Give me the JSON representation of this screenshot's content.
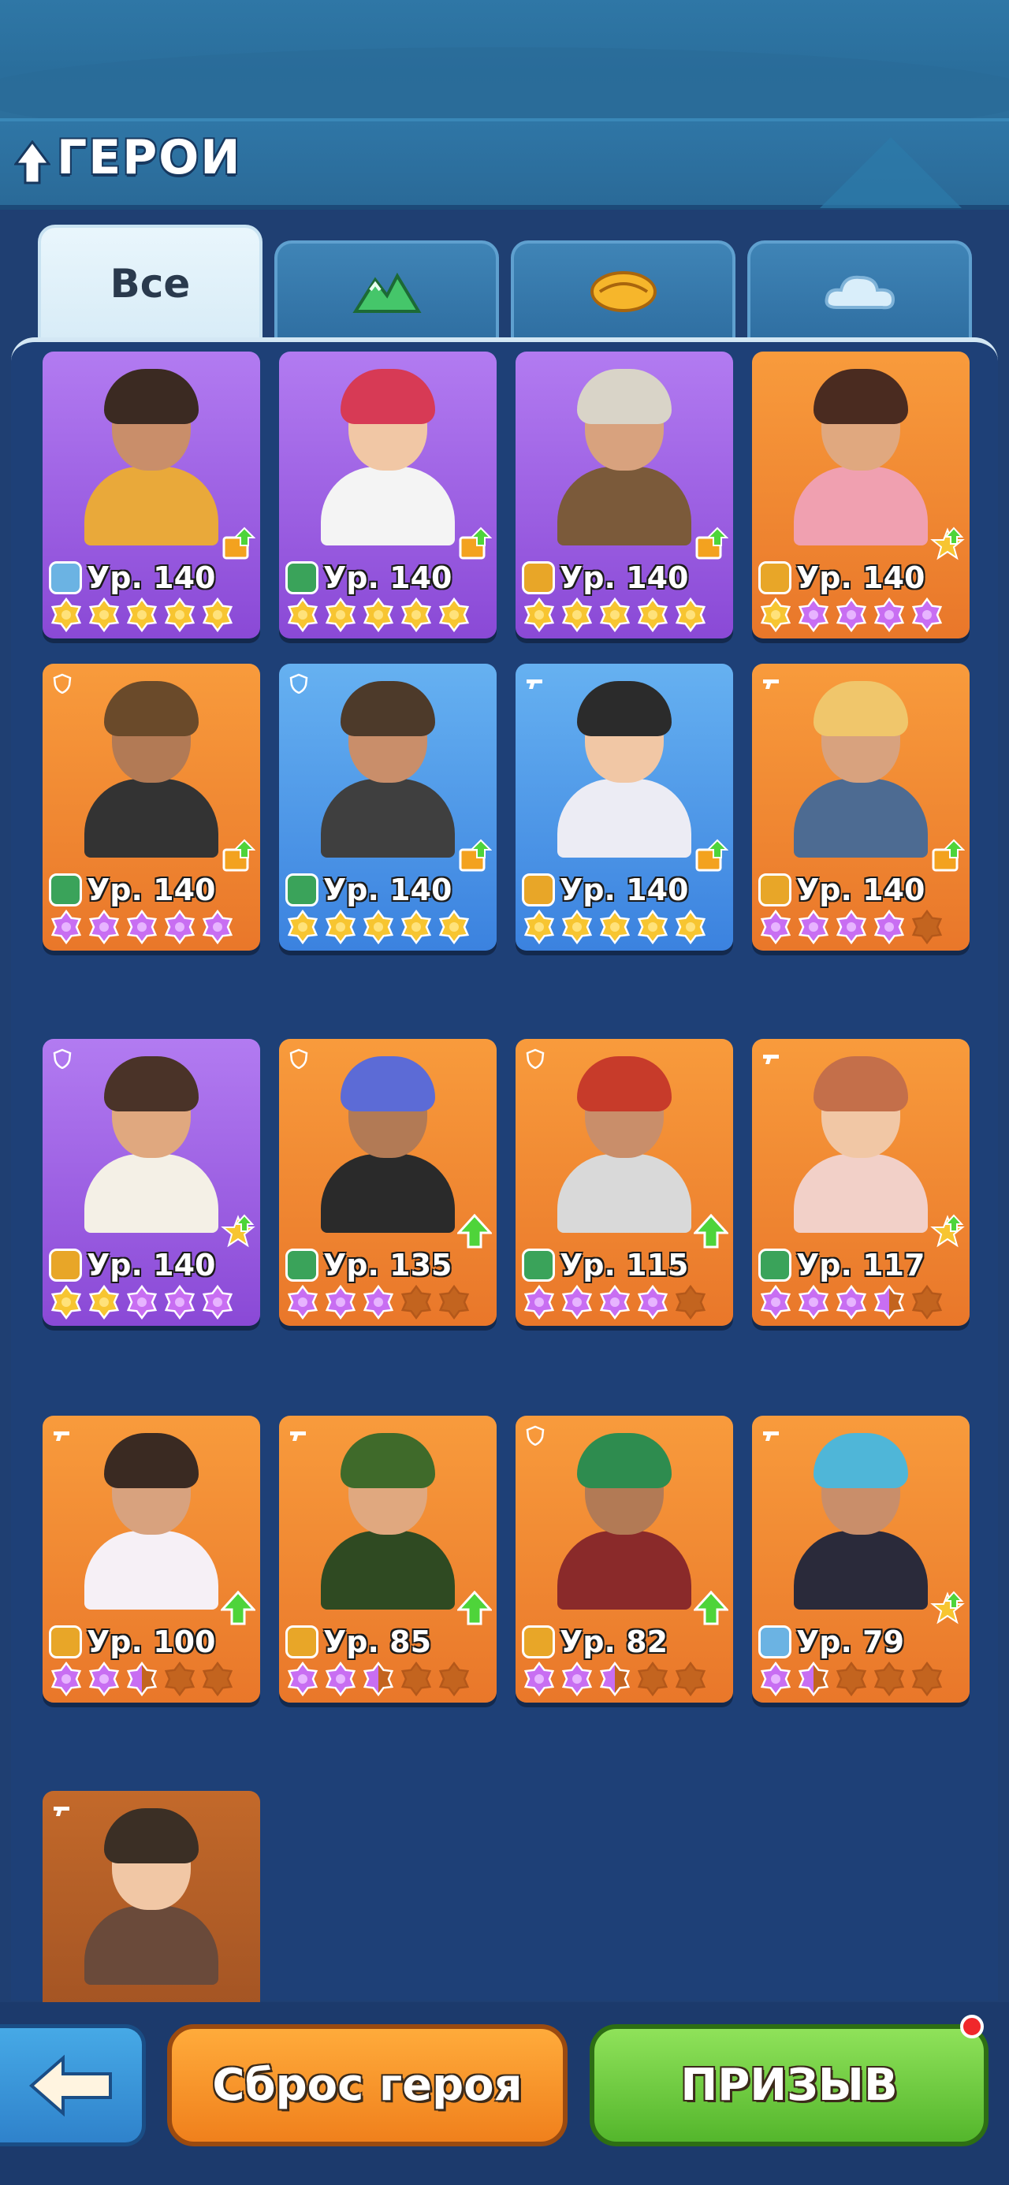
{
  "header": {
    "title": "ГЕРОИ"
  },
  "tabs": [
    {
      "label": "Все",
      "icon": "all",
      "active": true
    },
    {
      "label": "",
      "icon": "mountain-faction-icon",
      "active": false
    },
    {
      "label": "",
      "icon": "desert-faction-icon",
      "active": false
    },
    {
      "label": "",
      "icon": "cloud-faction-icon",
      "active": false
    }
  ],
  "colors": {
    "orange_card": "#f0872f",
    "purple_card": "#9a5ce3",
    "blue_card": "#4f98e8",
    "gold_star": "#f7c531",
    "purple_star": "#c86ef2",
    "empty_star": "#c3641f"
  },
  "heroes": [
    {
      "level": "Ур. 140",
      "card": "purple",
      "faction": "sky",
      "upgrade": "book",
      "stars": [
        "gold",
        "gold",
        "gold",
        "gold",
        "gold"
      ]
    },
    {
      "level": "Ур. 140",
      "card": "purple",
      "faction": "mountain",
      "upgrade": "book",
      "stars": [
        "gold",
        "gold",
        "gold",
        "gold",
        "gold"
      ]
    },
    {
      "level": "Ур. 140",
      "card": "purple",
      "faction": "desert",
      "upgrade": "book",
      "stars": [
        "gold",
        "gold",
        "gold",
        "gold",
        "gold"
      ]
    },
    {
      "level": "Ур. 140",
      "card": "orange",
      "faction": "desert",
      "upgrade": "star",
      "stars": [
        "gold",
        "purple",
        "purple",
        "purple",
        "purple"
      ]
    },
    {
      "level": "Ур. 140",
      "card": "orange",
      "faction": "mountain",
      "upgrade": "book",
      "role": "shield",
      "stars": [
        "purple",
        "purple",
        "purple",
        "purple",
        "purple"
      ]
    },
    {
      "level": "Ур. 140",
      "card": "blue",
      "faction": "mountain",
      "upgrade": "book",
      "role": "shield",
      "stars": [
        "gold",
        "gold",
        "gold",
        "gold",
        "gold"
      ]
    },
    {
      "level": "Ур. 140",
      "card": "blue",
      "faction": "desert",
      "upgrade": "book",
      "role": "gun",
      "stars": [
        "gold",
        "gold",
        "gold",
        "gold",
        "gold"
      ]
    },
    {
      "level": "Ур. 140",
      "card": "orange",
      "faction": "desert",
      "upgrade": "book",
      "role": "gun",
      "stars": [
        "purple",
        "purple",
        "purple",
        "purple",
        "empty"
      ]
    },
    {
      "level": "Ур. 140",
      "card": "purple",
      "faction": "desert",
      "upgrade": "star",
      "role": "shield",
      "stars": [
        "gold",
        "gold",
        "purple",
        "purple",
        "purple"
      ]
    },
    {
      "level": "Ур. 135",
      "card": "orange",
      "faction": "mountain",
      "upgrade": "arrow",
      "role": "shield",
      "stars": [
        "purple",
        "purple",
        "purple",
        "empty",
        "empty"
      ]
    },
    {
      "level": "Ур. 115",
      "card": "orange",
      "faction": "mountain",
      "upgrade": "arrow",
      "role": "shield",
      "stars": [
        "purple",
        "purple",
        "purple",
        "purple",
        "empty"
      ]
    },
    {
      "level": "Ур. 117",
      "card": "orange",
      "faction": "mountain",
      "upgrade": "star",
      "role": "gun",
      "stars": [
        "purple",
        "purple",
        "purple",
        "half",
        "empty"
      ]
    },
    {
      "level": "Ур. 100",
      "card": "orange",
      "faction": "desert",
      "upgrade": "arrow",
      "role": "gun",
      "stars": [
        "purple",
        "purple",
        "half",
        "empty",
        "empty"
      ]
    },
    {
      "level": "Ур. 85",
      "card": "orange",
      "faction": "desert",
      "upgrade": "arrow",
      "role": "gun",
      "stars": [
        "purple",
        "purple",
        "half",
        "empty",
        "empty"
      ]
    },
    {
      "level": "Ур. 82",
      "card": "orange",
      "faction": "desert",
      "upgrade": "arrow",
      "role": "shield",
      "stars": [
        "purple",
        "purple",
        "half",
        "empty",
        "empty"
      ]
    },
    {
      "level": "Ур. 79",
      "card": "orange",
      "faction": "sky",
      "upgrade": "star",
      "role": "gun",
      "stars": [
        "purple",
        "half",
        "empty",
        "empty",
        "empty"
      ]
    },
    {
      "level": "",
      "card": "brown",
      "faction": "",
      "upgrade": "",
      "role": "gun",
      "stars": []
    }
  ],
  "footer": {
    "back_label": "",
    "reset_label": "Сброс героя",
    "summon_label": "ПРИЗЫВ"
  }
}
